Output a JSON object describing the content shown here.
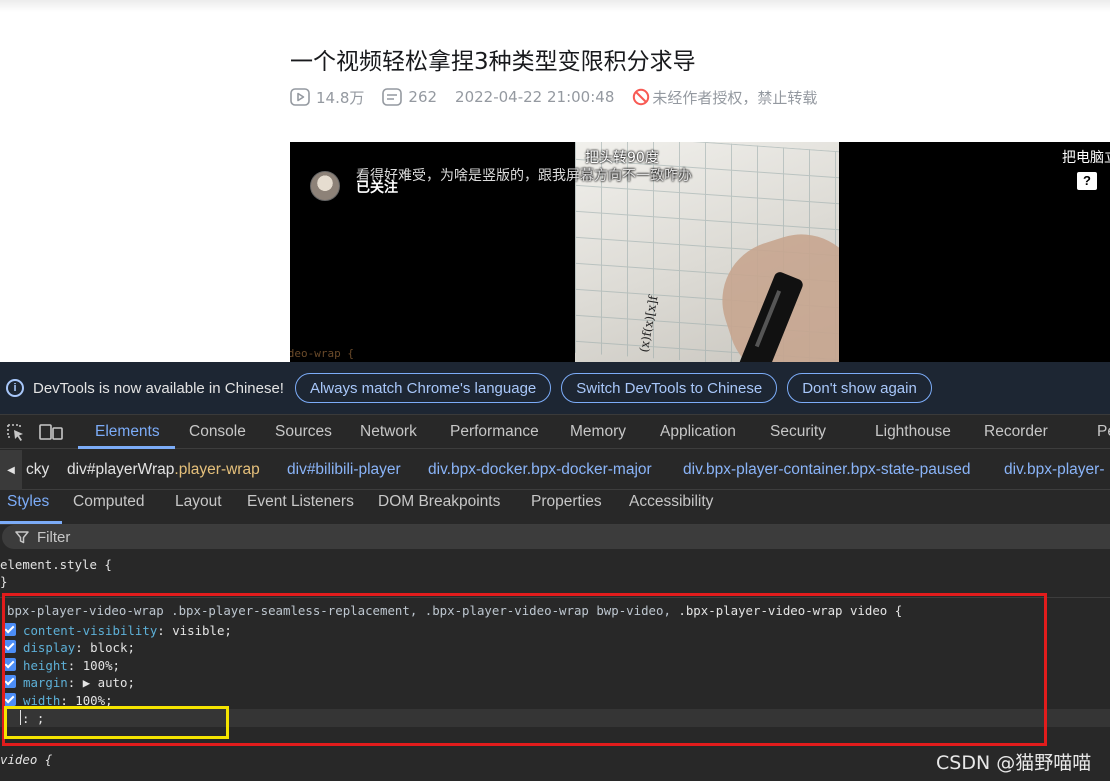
{
  "video": {
    "title": "一个视频轻松拿捏3种类型变限积分求导",
    "views": "14.8万",
    "danmaku_count": "262",
    "date": "2022-04-22 21:00:48",
    "copyright": "未经作者授权，禁止转载"
  },
  "player": {
    "follow_status": "已关注",
    "danmaku_1": "看得好难受，为啥是竖版的，跟我屏幕方向不一致咋办",
    "danmaku_2": "把头转90度",
    "danmaku_3": "把电脑立",
    "partial_code_line": ".bpx-player-video-wrap {"
  },
  "devtools": {
    "infobar": {
      "message": "DevTools is now available in Chinese!",
      "btn_match": "Always match Chrome's language",
      "btn_switch": "Switch DevTools to Chinese",
      "btn_dismiss": "Don't show again"
    },
    "tabs": [
      "Elements",
      "Console",
      "Sources",
      "Network",
      "Performance",
      "Memory",
      "Application",
      "Security",
      "Lighthouse",
      "Recorder",
      "Pe"
    ],
    "breadcrumbs": {
      "c0": "cky",
      "c1_tag": "div",
      "c1_id": "#playerWrap",
      "c1_cls": ".player-wrap",
      "c2": "div#bilibili-player",
      "c3": "div.bpx-docker.bpx-docker-major",
      "c4": "div.bpx-player-container.bpx-state-paused",
      "c5": "div.bpx-player-"
    },
    "subtabs": [
      "Styles",
      "Computed",
      "Layout",
      "Event Listeners",
      "DOM Breakpoints",
      "Properties",
      "Accessibility"
    ],
    "filter_placeholder": "Filter",
    "styles": {
      "element_style": "element.style {",
      "close_brace": "}",
      "selector_dim": "bpx-player-video-wrap .bpx-player-seamless-replacement, .bpx-player-video-wrap bwp-video, ",
      "selector_match": ".bpx-player-video-wrap video {",
      "decls": [
        {
          "prop": "content-visibility",
          "val": " visible;"
        },
        {
          "prop": "display",
          "val": " block;"
        },
        {
          "prop": "height",
          "val": " 100%;"
        },
        {
          "prop": "margin",
          "val": " ▶ auto;"
        },
        {
          "prop": "width",
          "val": " 100%;"
        }
      ],
      "editing_text": ": ;",
      "next_rule": "video {"
    }
  },
  "watermark": "CSDN @猫野喵喵"
}
